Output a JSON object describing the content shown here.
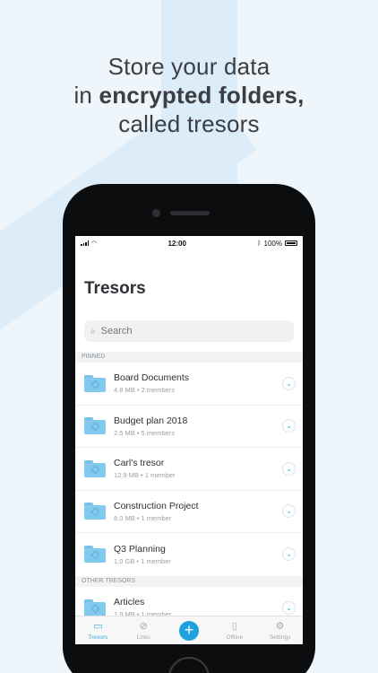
{
  "headline": {
    "line1": "Store your data",
    "line2_prefix": "in",
    "line2_bold": "encrypted folders,",
    "line3": "called tresors"
  },
  "statusbar": {
    "time": "12:00",
    "battery": "100%"
  },
  "screen": {
    "title": "Tresors"
  },
  "search": {
    "placeholder": "Search"
  },
  "sections": {
    "pinned": "PINNED",
    "other": "OTHER TRESORS"
  },
  "pinned": [
    {
      "name": "Board Documents",
      "meta": "4.8 MB • 2 members"
    },
    {
      "name": "Budget plan 2018",
      "meta": "2.5 MB • 5 members"
    },
    {
      "name": "Carl's tresor",
      "meta": "12.9 MB • 1 member"
    },
    {
      "name": "Construction Project",
      "meta": "8.0 MB • 1 member"
    },
    {
      "name": "Q3 Planning",
      "meta": "1.0 GB • 1 member"
    }
  ],
  "other": [
    {
      "name": "Articles",
      "meta": "1.9 MB • 1 member"
    }
  ],
  "tabs": [
    {
      "label": "Tresors",
      "icon": "folder-icon"
    },
    {
      "label": "Links",
      "icon": "link-icon"
    },
    {
      "label": "",
      "icon": "plus-icon"
    },
    {
      "label": "Offline",
      "icon": "offline-icon"
    },
    {
      "label": "Settings",
      "icon": "gear-icon"
    }
  ],
  "colors": {
    "accent": "#1ea1dc",
    "folder": "#82c9ee"
  }
}
